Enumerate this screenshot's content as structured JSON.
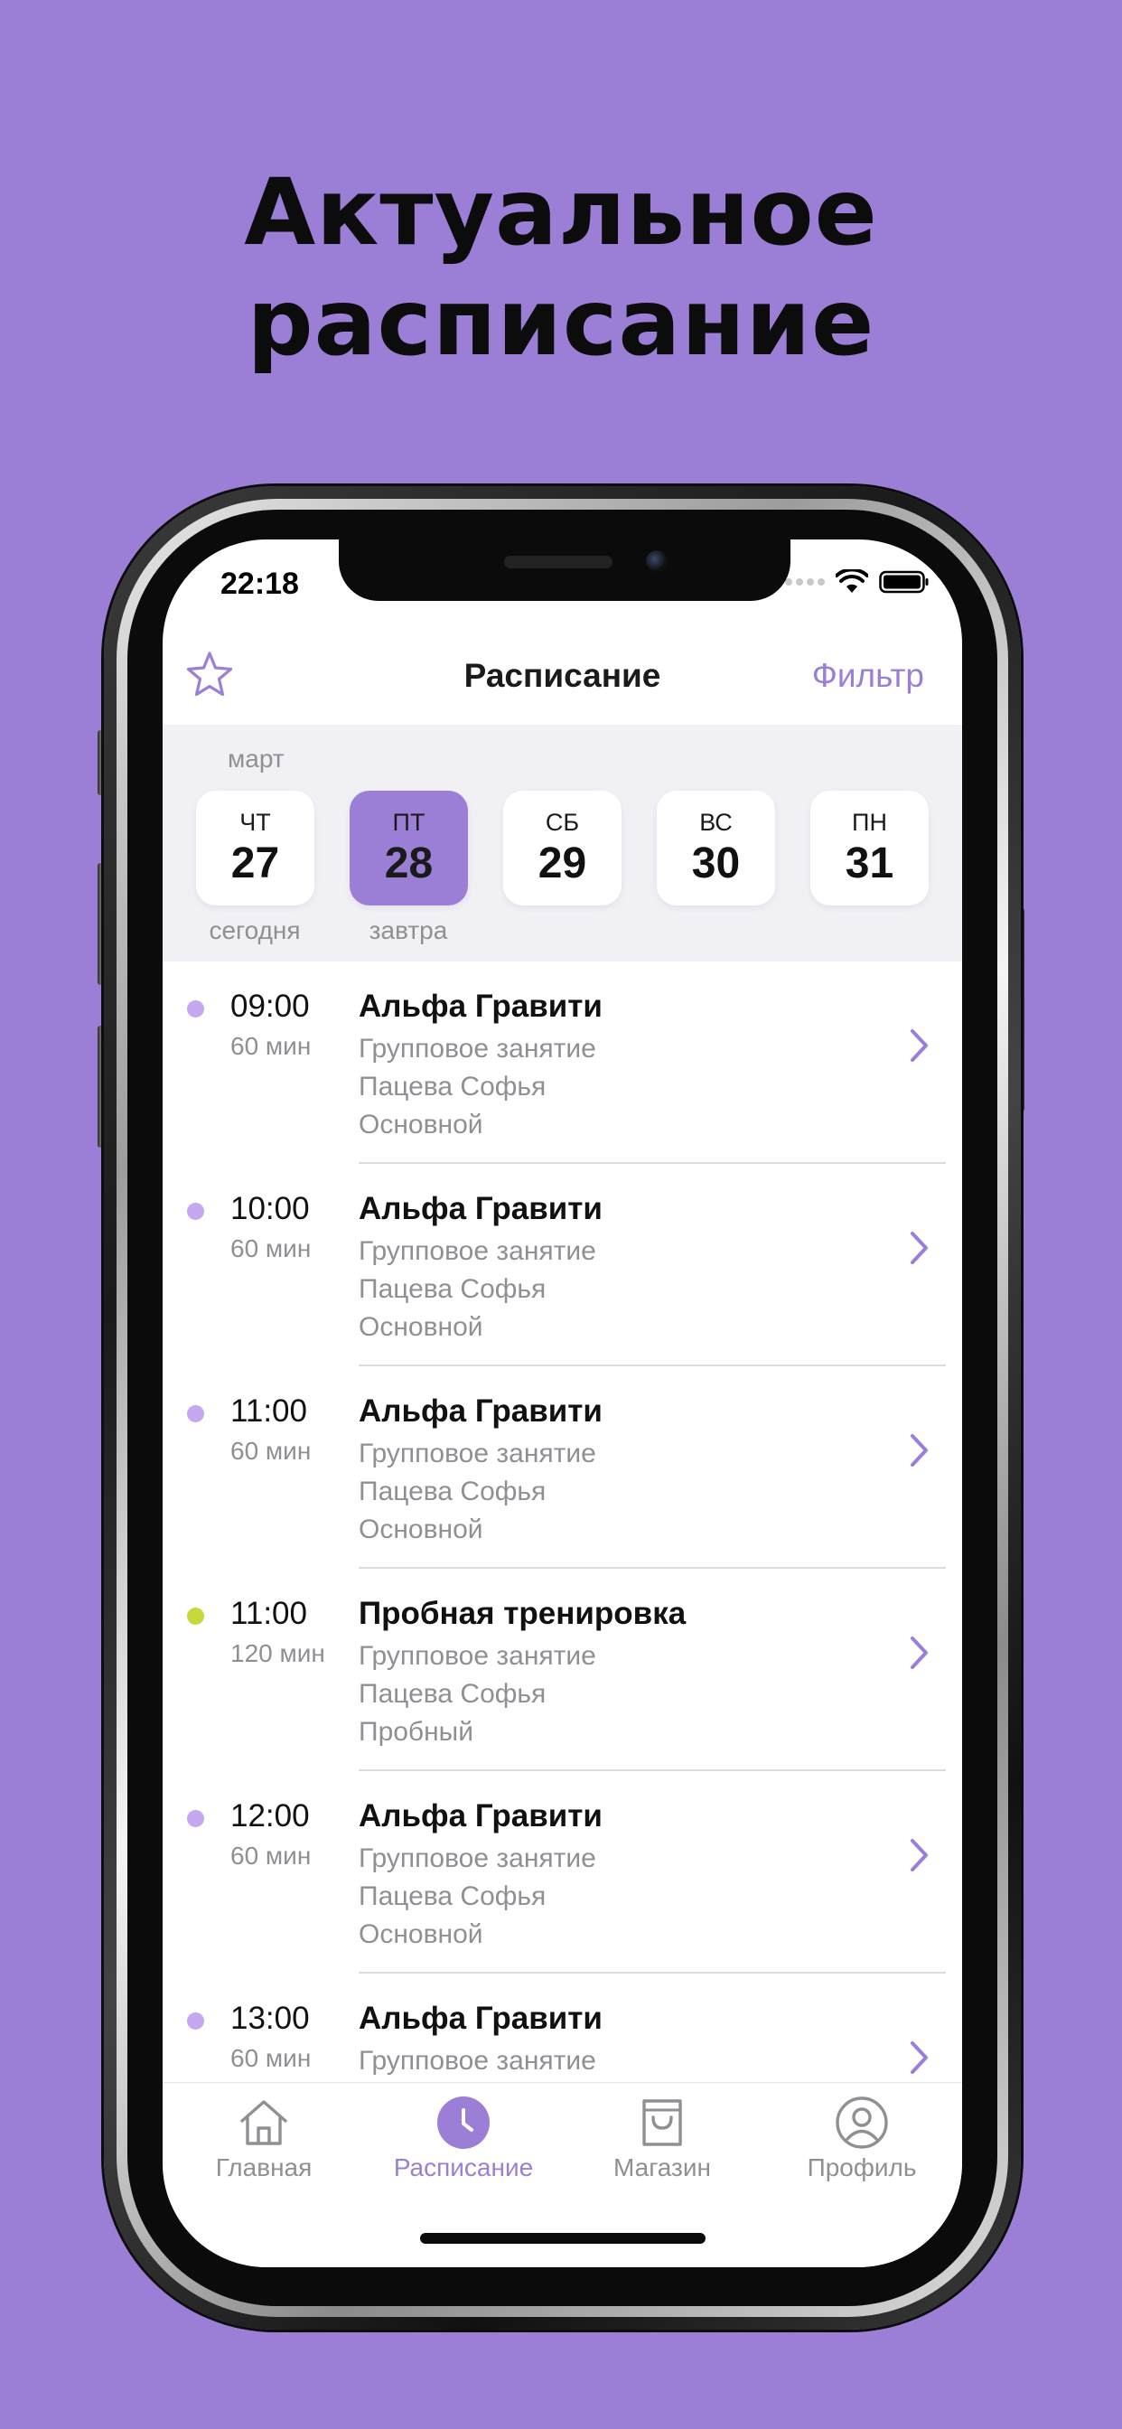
{
  "headline": {
    "line1": "Актуальное",
    "line2": "расписание"
  },
  "status_bar": {
    "time": "22:18"
  },
  "navbar": {
    "title": "Расписание",
    "filter_label": "Фильтр",
    "left_icon": "star-icon"
  },
  "calendar": {
    "month": "март",
    "days": [
      {
        "dow": "ЧТ",
        "num": "27",
        "sub": "сегодня",
        "selected": false
      },
      {
        "dow": "ПТ",
        "num": "28",
        "sub": "завтра",
        "selected": true
      },
      {
        "dow": "СБ",
        "num": "29",
        "sub": "",
        "selected": false
      },
      {
        "dow": "ВС",
        "num": "30",
        "sub": "",
        "selected": false
      },
      {
        "dow": "ПН",
        "num": "31",
        "sub": "",
        "selected": false
      }
    ]
  },
  "classes": [
    {
      "time": "09:00",
      "duration": "60 мин",
      "title": "Альфа Гравити",
      "type": "Групповое занятие",
      "trainer": "Пацева Софья",
      "hall": "Основной",
      "dot_color": "#C4A8F2"
    },
    {
      "time": "10:00",
      "duration": "60 мин",
      "title": "Альфа Гравити",
      "type": "Групповое занятие",
      "trainer": "Пацева Софья",
      "hall": "Основной",
      "dot_color": "#C4A8F2"
    },
    {
      "time": "11:00",
      "duration": "60 мин",
      "title": "Альфа Гравити",
      "type": "Групповое занятие",
      "trainer": "Пацева Софья",
      "hall": "Основной",
      "dot_color": "#C4A8F2"
    },
    {
      "time": "11:00",
      "duration": "120 мин",
      "title": "Пробная тренировка",
      "type": "Групповое занятие",
      "trainer": "Пацева Софья",
      "hall": "Пробный",
      "dot_color": "#C7D93A"
    },
    {
      "time": "12:00",
      "duration": "60 мин",
      "title": "Альфа Гравити",
      "type": "Групповое занятие",
      "trainer": "Пацева Софья",
      "hall": "Основной",
      "dot_color": "#C4A8F2"
    },
    {
      "time": "13:00",
      "duration": "60 мин",
      "title": "Альфа Гравити",
      "type": "Групповое занятие",
      "trainer": "",
      "hall": "",
      "dot_color": "#C4A8F2"
    }
  ],
  "tabbar": {
    "tabs": [
      {
        "label": "Главная",
        "icon": "home-icon",
        "active": false
      },
      {
        "label": "Расписание",
        "icon": "clock-icon",
        "active": true
      },
      {
        "label": "Магазин",
        "icon": "shopping-bag-icon",
        "active": false
      },
      {
        "label": "Профиль",
        "icon": "profile-icon",
        "active": false
      }
    ]
  },
  "colors": {
    "background": "#9B7FD6",
    "accent": "#9B7FD6",
    "trial_dot": "#C7D93A"
  }
}
